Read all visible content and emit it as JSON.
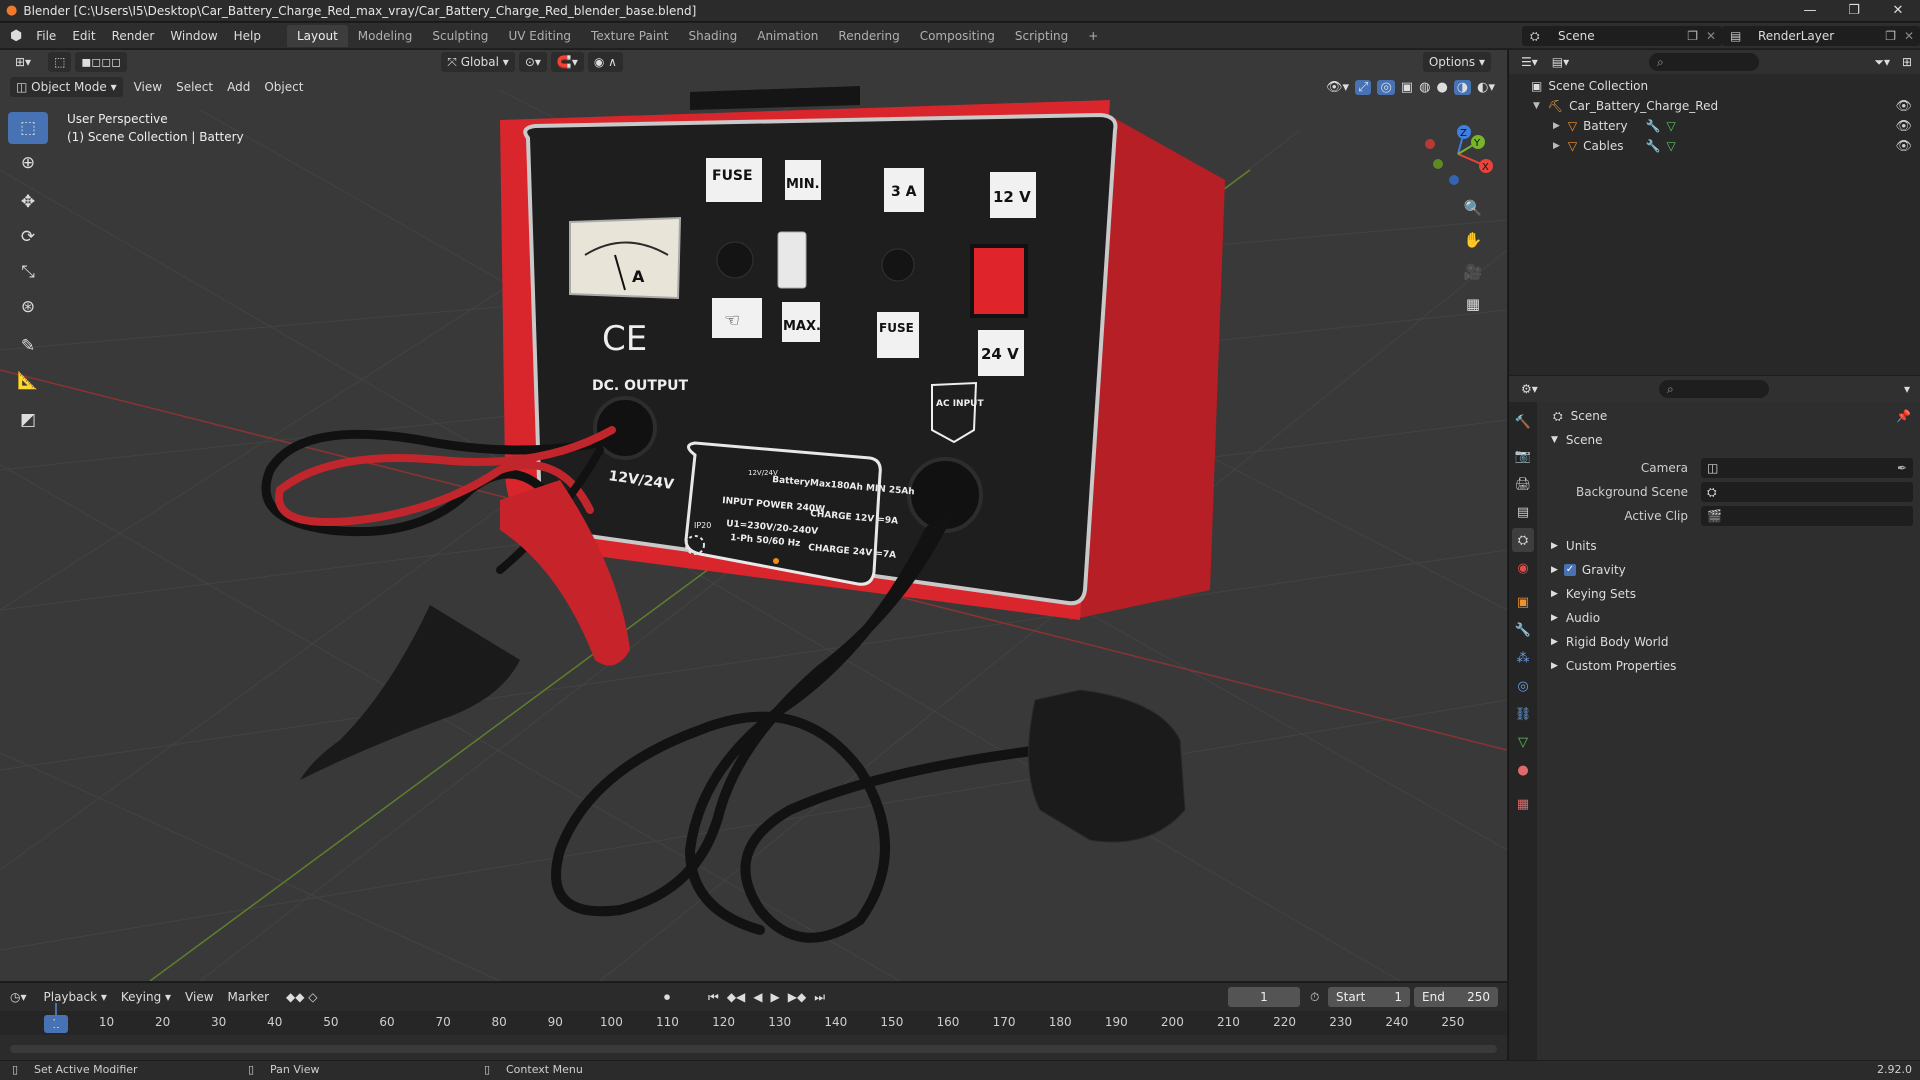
{
  "window": {
    "title": "Blender [C:\\Users\\I5\\Desktop\\Car_Battery_Charge_Red_max_vray/Car_Battery_Charge_Red_blender_base.blend]",
    "controls": [
      "—",
      "❐",
      "✕"
    ]
  },
  "menu": [
    "File",
    "Edit",
    "Render",
    "Window",
    "Help"
  ],
  "workspaces": [
    {
      "label": "Layout",
      "active": true
    },
    {
      "label": "Modeling"
    },
    {
      "label": "Sculpting"
    },
    {
      "label": "UV Editing"
    },
    {
      "label": "Texture Paint"
    },
    {
      "label": "Shading"
    },
    {
      "label": "Animation"
    },
    {
      "label": "Rendering"
    },
    {
      "label": "Compositing"
    },
    {
      "label": "Scripting"
    },
    {
      "label": "+"
    }
  ],
  "scene_selector": "Scene",
  "render_layer": "RenderLayer",
  "viewport": {
    "transform_orientation": "Global",
    "options": "Options",
    "mode": "Object Mode",
    "header_menus": [
      "View",
      "Select",
      "Add",
      "Object"
    ],
    "info_line1": "User Perspective",
    "info_line2": "(1) Scene Collection | Battery",
    "gizmo_axes": [
      "X",
      "Y",
      "Z"
    ]
  },
  "model_labels": {
    "fuse_top": "FUSE",
    "min": "MIN.",
    "amp_3": "3 A",
    "v12": "12 V",
    "max": "MAX.",
    "fuse_bottom": "FUSE",
    "v24": "24 V",
    "ce": "CE",
    "dc_output": "DC. OUTPUT",
    "output_voltage": "12V/24V",
    "ac_input": "AC INPUT",
    "meter_label": "A",
    "plate_line1": "BatteryMax180Ah MIN 25Ah",
    "plate_line2": "INPUT POWER 240W",
    "plate_line3": "CHARGE 12V =9A",
    "plate_line4": "U1=230V/20-240V",
    "plate_line5": "1-Ph 50/60 Hz",
    "plate_line6": "CHARGE 24V =7A",
    "plate_ip": "IP20",
    "plate_icon": "12V/24V"
  },
  "timeline": {
    "menus": [
      "Playback",
      "Keying",
      "View",
      "Marker"
    ],
    "current_frame": "1",
    "start_label": "Start",
    "start": "1",
    "end_label": "End",
    "end": "250",
    "ruler": [
      "10",
      "20",
      "30",
      "40",
      "50",
      "60",
      "70",
      "80",
      "90",
      "100",
      "110",
      "120",
      "130",
      "140",
      "150",
      "160",
      "170",
      "180",
      "190",
      "200",
      "210",
      "220",
      "230",
      "240",
      "250"
    ],
    "cursor": "1"
  },
  "status": {
    "left": "Set Active Modifier",
    "middle": "Pan View",
    "right": "Context Menu",
    "version": "2.92.0"
  },
  "outliner": {
    "root": "Scene Collection",
    "collection": "Car_Battery_Charge_Red",
    "items": [
      "Battery",
      "Cables"
    ]
  },
  "properties": {
    "scene_name": "Scene",
    "panel_title": "Scene",
    "camera_label": "Camera",
    "bg_scene_label": "Background Scene",
    "active_clip_label": "Active Clip",
    "sections": [
      "Units",
      "Gravity",
      "Keying Sets",
      "Audio",
      "Rigid Body World",
      "Custom Properties"
    ]
  },
  "colors": {
    "accent": "#4772b3",
    "charger_red": "#d8262c",
    "panel_black": "#1e1e1e"
  }
}
